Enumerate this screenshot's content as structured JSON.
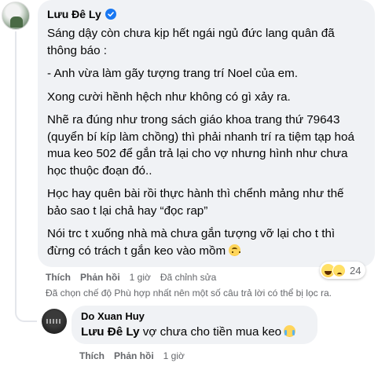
{
  "main_comment": {
    "author": "Lưu Đê Ly",
    "paragraphs": [
      "Sáng dậy còn chưa kịp hết ngái ngủ đức lang quân đã thông báo :",
      "- Anh vừa làm gãy tượng trang trí Noel của em.",
      "Xong cười hềnh hệch như không có gì xảy ra.",
      "Nhẽ ra đúng như trong sách giáo khoa trang thứ 79643 (quyển bí kíp làm chồng) thì phải nhanh trí ra tiệm tạp hoá mua keo 502 để gắn trả lại cho vợ nhưng hình như chưa học thuộc đoạn đó..",
      "Học hay quên bài rồi thực hành thì chểnh mảng như thế bảo sao t lại chả hay “đọc rap”",
      "Nói trc t xuống nhà mà chưa gắn tượng vỡ lại cho t thì đừng có trách t gắn keo vào mồm"
    ],
    "reaction_count": "24",
    "actions": {
      "like": "Thích",
      "reply": "Phản hồi",
      "time": "1 giờ",
      "edited": "Đã chỉnh sửa"
    }
  },
  "filter_note": "Đã chọn chế độ Phù hợp nhất nên một số câu trả lời có thể bị lọc ra.",
  "reply_comment": {
    "author": "Do Xuan Huy",
    "mention": "Lưu Đê Ly",
    "text": " vợ chưa cho tiền mua keo",
    "actions": {
      "like": "Thích",
      "reply": "Phản hồi",
      "time": "1 giờ"
    }
  },
  "icons": {
    "verified": "verified-badge-icon",
    "reaction_haha": "haha-reaction-icon",
    "reaction_sad": "sad-reaction-icon",
    "emoji_upside_down": "upside-down-face-emoji",
    "emoji_crying": "loudly-crying-face-emoji"
  },
  "colors": {
    "bubble": "#f0f2f5",
    "secondary_text": "#65676b",
    "verified": "#1877f2"
  }
}
